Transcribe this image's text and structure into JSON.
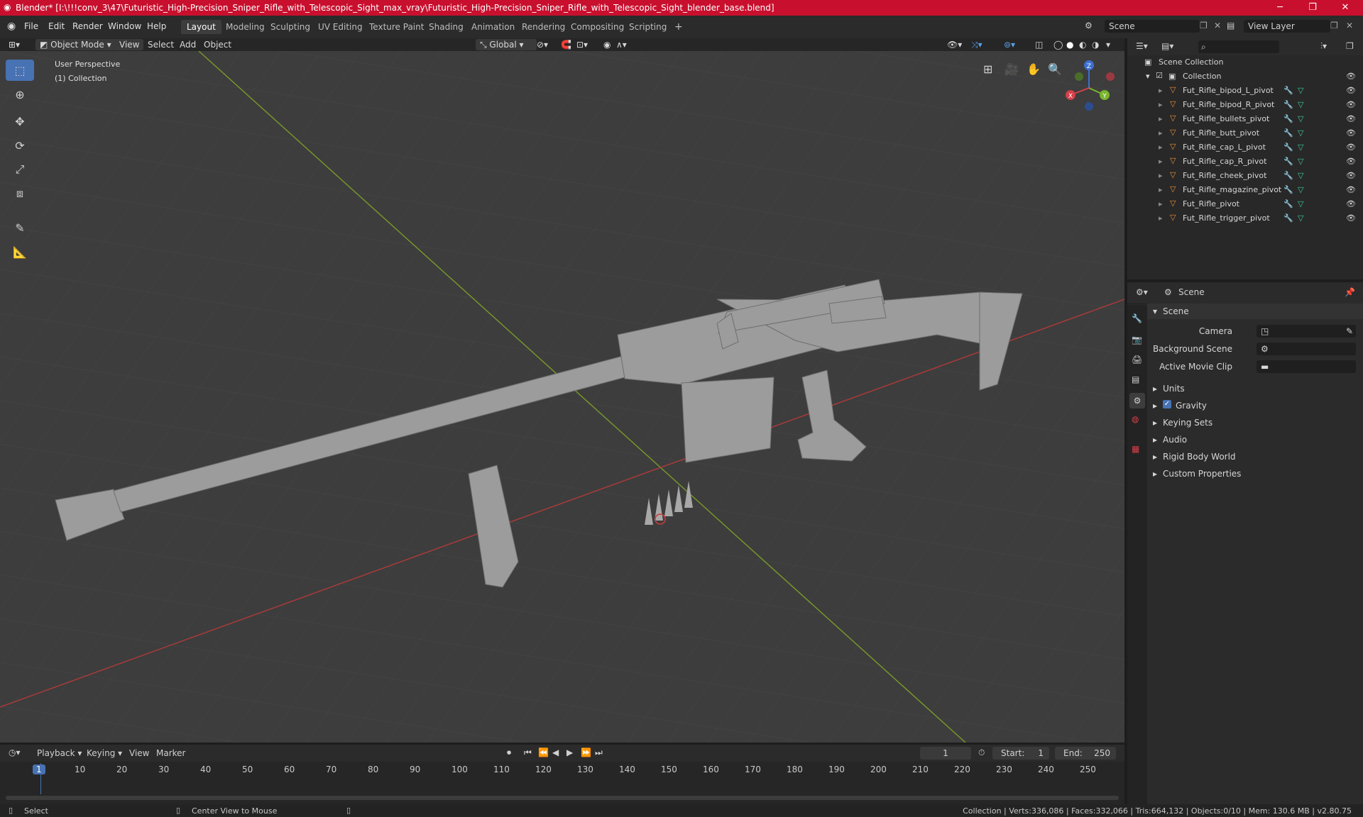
{
  "titlebar": {
    "title": "Blender* [I:\\!!!conv_3\\47\\Futuristic_High-Precision_Sniper_Rifle_with_Telescopic_Sight_max_vray\\Futuristic_High-Precision_Sniper_Rifle_with_Telescopic_Sight_blender_base.blend]",
    "bg": "#c8102e"
  },
  "menu": [
    "File",
    "Edit",
    "Render",
    "Window",
    "Help"
  ],
  "workspaces": [
    "Layout",
    "Modeling",
    "Sculpting",
    "UV Editing",
    "Texture Paint",
    "Shading",
    "Animation",
    "Rendering",
    "Compositing",
    "Scripting"
  ],
  "active_workspace": "Layout",
  "scene_selector": "Scene",
  "view_layer_selector": "View Layer",
  "viewport_header": {
    "mode": "Object Mode",
    "menus": [
      "View",
      "Select",
      "Add",
      "Object"
    ],
    "transform_orientation": "Global"
  },
  "viewport": {
    "perspective": "User Perspective",
    "collection": "(1) Collection",
    "gizmo_axes": {
      "x": "X",
      "y": "Y",
      "z": "Z"
    }
  },
  "outliner": {
    "root": "Scene Collection",
    "collection": "Collection",
    "objects": [
      "Fut_Rifle_bipod_L_pivot",
      "Fut_Rifle_bipod_R_pivot",
      "Fut_Rifle_bullets_pivot",
      "Fut_Rifle_butt_pivot",
      "Fut_Rifle_cap_L_pivot",
      "Fut_Rifle_cap_R_pivot",
      "Fut_Rifle_cheek_pivot",
      "Fut_Rifle_magazine_pivot",
      "Fut_Rifle_pivot",
      "Fut_Rifle_trigger_pivot"
    ]
  },
  "properties": {
    "header": "Scene",
    "panel": "Scene",
    "camera_label": "Camera",
    "background_scene_label": "Background Scene",
    "active_movie_clip_label": "Active Movie Clip",
    "sections": [
      "Units",
      "Gravity",
      "Keying Sets",
      "Audio",
      "Rigid Body World",
      "Custom Properties"
    ]
  },
  "timeline": {
    "menus": [
      "Playback",
      "Keying",
      "View",
      "Marker"
    ],
    "current_frame": "1",
    "start_label": "Start:",
    "start": "1",
    "end_label": "End:",
    "end": "250",
    "ticks": [
      "1",
      "10",
      "20",
      "30",
      "40",
      "50",
      "60",
      "70",
      "80",
      "90",
      "100",
      "110",
      "120",
      "130",
      "140",
      "150",
      "160",
      "170",
      "180",
      "190",
      "200",
      "210",
      "220",
      "230",
      "240",
      "250"
    ]
  },
  "statusbar": {
    "left": "Select",
    "middle": "Center View to Mouse",
    "stats": "Collection | Verts:336,086 | Faces:332,066 | Tris:664,132 | Objects:0/10 | Mem: 130.6 MB | v2.80.75"
  },
  "colors": {
    "accent": "#4772b3",
    "object_icon": "#e8903a",
    "modifier_icon": "#5aa0e8",
    "mesh_icon": "#3ec8a0"
  }
}
